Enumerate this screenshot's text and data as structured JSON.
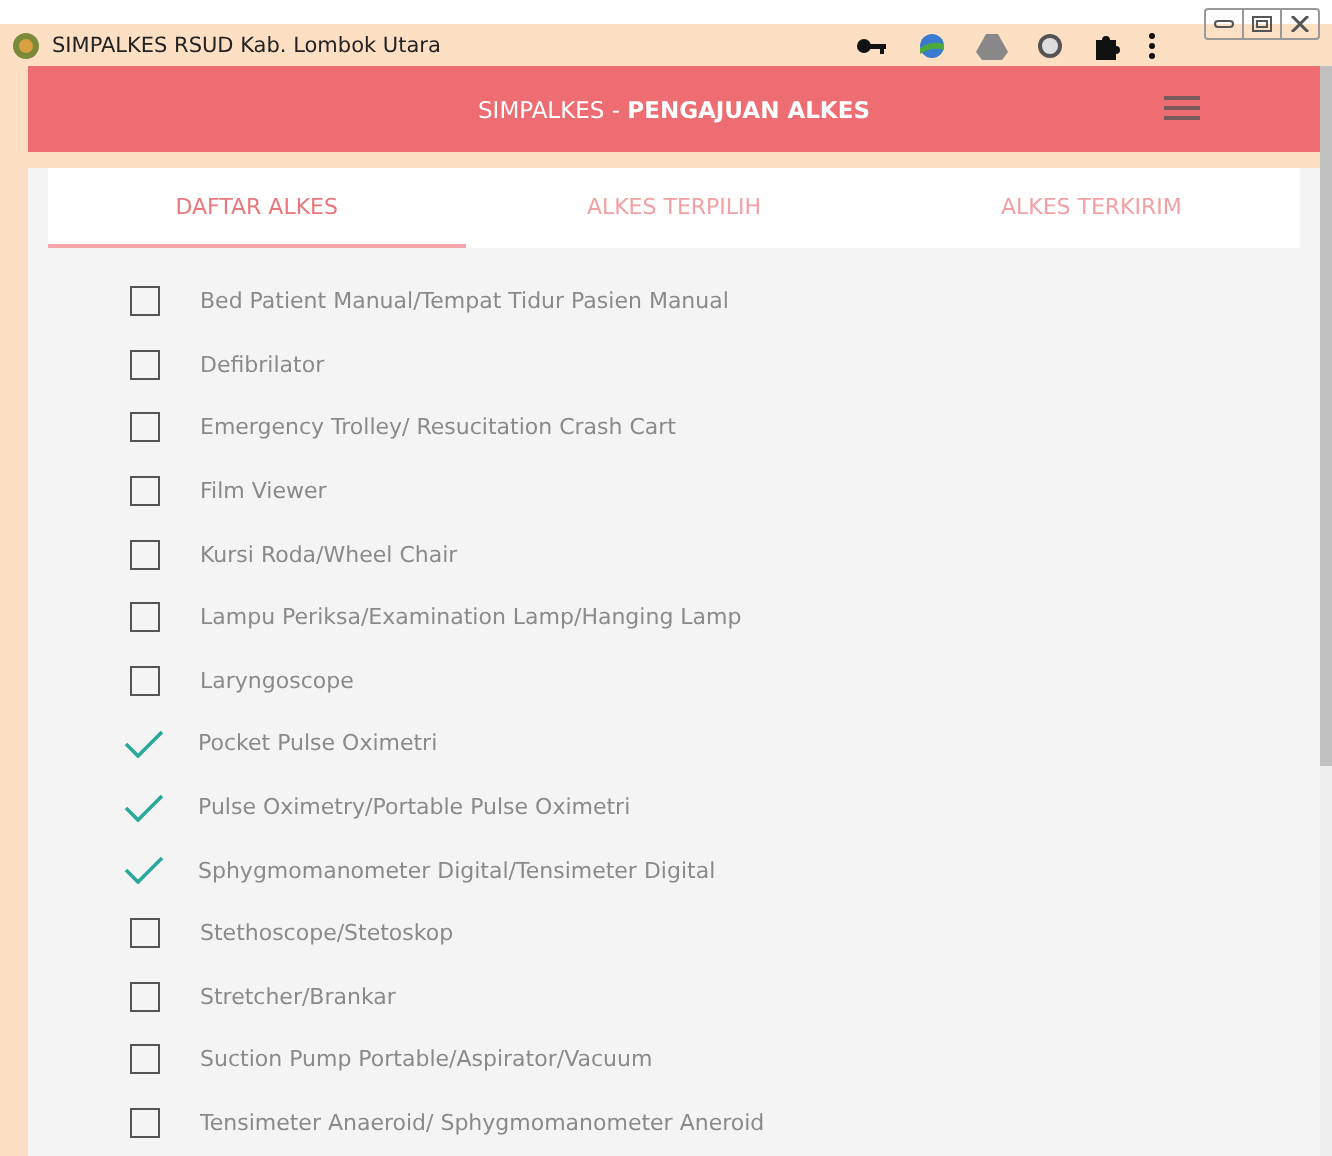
{
  "window": {
    "title": "SIMPALKES RSUD Kab. Lombok Utara"
  },
  "header": {
    "title": "SIMPALKES - **PENGAJUAN ALKES**"
  },
  "tabs": [
    {
      "label": "DAFTAR ALKES",
      "selected": true
    },
    {
      "label": "ALKES TERPILIH",
      "selected": false
    },
    {
      "label": "ALKES TERKIRIM",
      "selected": false
    }
  ],
  "items": [
    {
      "label": "Bed Patient Manual/Tempat Tidur Pasien Manual",
      "checked": false
    },
    {
      "label": "Defibrilator",
      "checked": false
    },
    {
      "label": "Emergency Trolley/ Resucitation Crash Cart",
      "checked": false
    },
    {
      "label": "Film Viewer",
      "checked": false
    },
    {
      "label": "Kursi Roda/Wheel Chair",
      "checked": false
    },
    {
      "label": "Lampu Periksa/Examination Lamp/Hanging Lamp",
      "checked": false
    },
    {
      "label": "Laryngoscope",
      "checked": false
    },
    {
      "label": "Pocket Pulse Oximetri",
      "checked": true
    },
    {
      "label": "Pulse Oximetry/Portable Pulse Oximetri",
      "checked": true
    },
    {
      "label": "Sphygmomanometer Digital/Tensimeter Digital",
      "checked": true
    },
    {
      "label": "Stethoscope/Stetoskop",
      "checked": false
    },
    {
      "label": "Stretcher/Brankar",
      "checked": false
    },
    {
      "label": "Suction Pump Portable/Aspirator/Vacuum",
      "checked": false
    },
    {
      "label": "Tensimeter Anaeroid/ Sphygmomanometer Aneroid",
      "checked": false
    }
  ]
}
